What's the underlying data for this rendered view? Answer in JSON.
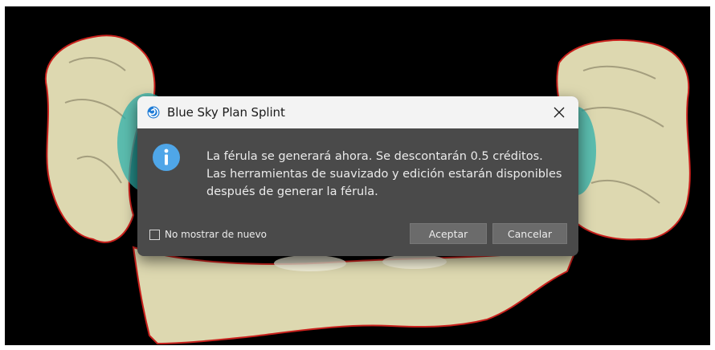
{
  "background": {
    "scene": "dental-3d-model-view",
    "colors": {
      "canvas": "#000000",
      "model": "#ddd8b0",
      "outline": "#c8201c",
      "mesh": "#2fb3ad"
    }
  },
  "dialog": {
    "title": "Blue Sky Plan Splint",
    "app_icon": "blue-sky-plan-icon",
    "close_icon": "close-icon",
    "info_icon": "info-icon",
    "message_lines": [
      "La férula se generará ahora. Se descontarán 0.5 créditos.",
      "Las herramientas de suavizado y edición estarán disponibles",
      "después de generar la férula."
    ],
    "checkbox": {
      "label": "No mostrar de nuevo",
      "checked": false
    },
    "buttons": {
      "accept": "Aceptar",
      "cancel": "Cancelar"
    },
    "colors": {
      "body": "#4a4a4a",
      "titlebar": "#f3f3f3",
      "info": "#4fa6e8",
      "button": "#6b6b6b"
    }
  }
}
